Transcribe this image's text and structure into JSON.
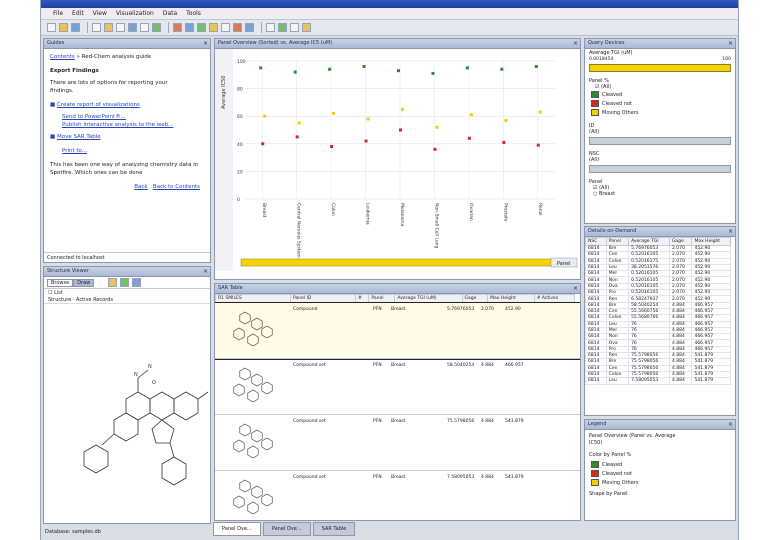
{
  "menu": [
    "File",
    "Edit",
    "View",
    "Visualization",
    "Data",
    "Tools"
  ],
  "guide": {
    "header": "Guides",
    "crumb_link": "Contents",
    "crumb_rest": "» Red-Chem analysis guide",
    "section_title": "Export Findings",
    "intro": "There are lots of options for reporting your findings.",
    "items": [
      "Create report of visualizations",
      "Send to PowerPoint®...",
      "Publish interactive analysis to the web...",
      "Move SAR Table",
      "Print to..."
    ],
    "outro": "This has been one way of analyzing chemistry data in Spotfire. Which ones can be done",
    "back": "Back",
    "back_contents": "Back to Contents",
    "status": "Connected to localhost"
  },
  "structure": {
    "header": "Structure Viewer",
    "tab_browse": "Browse",
    "tab_draw": "Draw",
    "list_label": "List",
    "col_a": "Structure",
    "col_b": "Active Records",
    "status": "Database: samples.db"
  },
  "plot": {
    "header": "Panel Overview (Sorted) vs. Average IC5 (uM)",
    "yaxis": "Average IC50",
    "yticks": [
      "100",
      "80",
      "60",
      "40",
      "20",
      "0"
    ],
    "panel_btn": "Panel"
  },
  "chart_data": {
    "type": "scatter",
    "title": "Panel Overview (Sorted) vs. Average IC5 (uM)",
    "ylabel": "Average IC50",
    "ylim": [
      0,
      100
    ],
    "categories": [
      "Breast",
      "Central Nervous System",
      "Colon",
      "Leukemia",
      "Melanoma",
      "Non-Small Cell Lung",
      "Ovarian",
      "Prostate",
      "Renal"
    ],
    "series": [
      {
        "name": "Cleaved",
        "values": [
          95,
          92,
          94,
          96,
          93,
          91,
          95,
          94,
          96
        ]
      },
      {
        "name": "Cleaved not",
        "values": [
          40,
          45,
          38,
          42,
          50,
          36,
          44,
          41,
          39
        ]
      },
      {
        "name": "Moving Others",
        "values": [
          60,
          55,
          62,
          58,
          65,
          52,
          61,
          57,
          63
        ]
      }
    ]
  },
  "sar": {
    "header": "SAR Table",
    "columns": [
      "R1 SMILES",
      "Panel ID",
      "#",
      "Panel",
      "Average TGI (uM)",
      "Gage",
      "Max Height",
      "# Actives"
    ],
    "rows": [
      {
        "name": "Compound",
        "id": "PFN",
        "panel": "Breast",
        "val": "5.76976053",
        "gage": "2.070",
        "max": "452.90"
      },
      {
        "name": "Compound set",
        "id": "PFN",
        "panel": "Breast",
        "val": "58.5040254",
        "gage": "4.884",
        "max": "466.957"
      },
      {
        "name": "Compound set",
        "id": "PFN",
        "panel": "Breast",
        "val": "75.5798056",
        "gage": "4.884",
        "max": "541.879"
      },
      {
        "name": "Compound set",
        "id": "PFN",
        "panel": "Breast",
        "val": "7.58095053",
        "gage": "4.884",
        "max": "541.879"
      }
    ]
  },
  "tabs": [
    "Panel Ove...",
    "Panel Ove...",
    "SAR Table"
  ],
  "query": {
    "header": "Query Devices",
    "f1": "Average TGI (uM)",
    "f1_range_lo": "0.0018454",
    "f1_range_hi": "100",
    "f2": "Panel %",
    "f2_all": "(All)",
    "f2_opts": [
      "Cleaved",
      "Cleaved not",
      "Moving Others"
    ],
    "f3": "ID",
    "f3_all": "(All)",
    "f4": "NSC",
    "f4_all": "(All)",
    "f5": "Panel",
    "f5_all": "(All)",
    "f5_opt": "Breast"
  },
  "details": {
    "header": "Details-on-Demand",
    "columns": [
      "NSC",
      "Panel",
      "Average TGI",
      "Gage",
      "Max Height"
    ],
    "rows": [
      [
        "6814",
        "Bre",
        "5.76976053",
        "2.070",
        "452.90"
      ],
      [
        "6814",
        "Cen",
        "0.52016105",
        "2.070",
        "452.90"
      ],
      [
        "6814",
        "Colon",
        "0.52016175",
        "2.070",
        "452.90"
      ],
      [
        "6814",
        "Leu",
        "38.2053576",
        "2.070",
        "452.90"
      ],
      [
        "6814",
        "Mel",
        "0.52016105",
        "2.070",
        "452.90"
      ],
      [
        "6814",
        "Non",
        "0.52016105",
        "2.070",
        "452.90"
      ],
      [
        "6814",
        "Ova",
        "0.52016105",
        "2.070",
        "452.90"
      ],
      [
        "6814",
        "Pro",
        "0.52016105",
        "2.070",
        "452.90"
      ],
      [
        "6814",
        "Ren",
        "6.58247937",
        "2.070",
        "452.90"
      ],
      [
        "6814",
        "Bre",
        "58.5040254",
        "4.884",
        "466.957"
      ],
      [
        "6814",
        "Cen",
        "55.5660756",
        "4.884",
        "466.957"
      ],
      [
        "6814",
        "Colon",
        "55.5680766",
        "4.884",
        "466.957"
      ],
      [
        "6814",
        "Leu",
        "76",
        "4.884",
        "466.957"
      ],
      [
        "6814",
        "Mel",
        "76",
        "4.884",
        "466.957"
      ],
      [
        "6814",
        "Non",
        "76",
        "4.884",
        "466.957"
      ],
      [
        "6814",
        "Ova",
        "76",
        "4.884",
        "466.957"
      ],
      [
        "6814",
        "Pro",
        "76",
        "4.884",
        "466.957"
      ],
      [
        "6814",
        "Ren",
        "75.5798056",
        "4.884",
        "541.879"
      ],
      [
        "6814",
        "Bre",
        "75.5798056",
        "4.884",
        "541.879"
      ],
      [
        "6814",
        "Cen",
        "75.5798056",
        "4.884",
        "541.879"
      ],
      [
        "6814",
        "Colon",
        "75.5798056",
        "4.884",
        "541.879"
      ],
      [
        "6814",
        "Leu",
        "7.58095053",
        "4.884",
        "541.879"
      ]
    ]
  },
  "legend": {
    "header": "Legend",
    "line1": "Panel Overview (Panel vs. Average IC50)",
    "color_by": "Color by Panel %",
    "items": [
      {
        "label": "Cleaved",
        "color": "#2e8b2e"
      },
      {
        "label": "Cleaved not",
        "color": "#d62a1e"
      },
      {
        "label": "Moving Others",
        "color": "#f0d000"
      }
    ],
    "shape_by": "Shape by Panel"
  }
}
